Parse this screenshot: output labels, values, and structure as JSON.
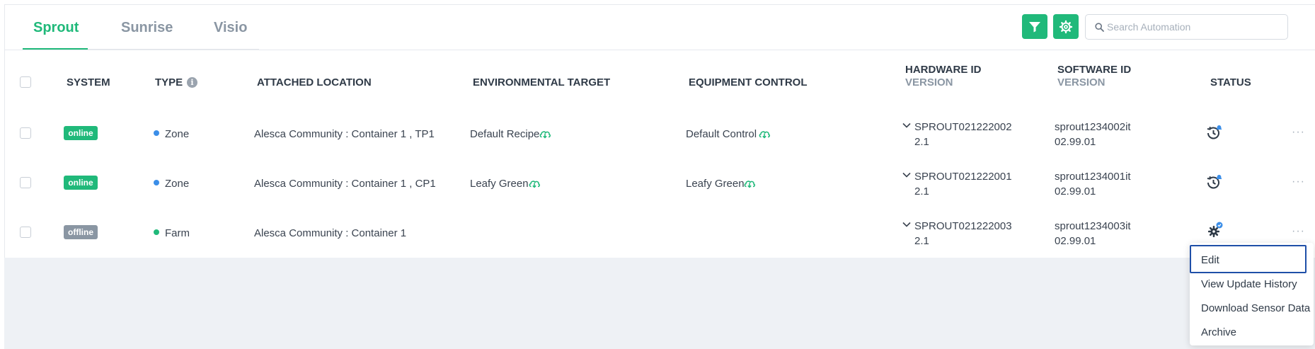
{
  "tabs": [
    {
      "label": "Sprout",
      "active": true
    },
    {
      "label": "Sunrise",
      "active": false
    },
    {
      "label": "Visio",
      "active": false
    }
  ],
  "toolbar": {
    "filter_icon": "filter-icon",
    "settings_icon": "gear-icon",
    "search_placeholder": "Search Automation",
    "search_value": ""
  },
  "table": {
    "headers": {
      "system": "SYSTEM",
      "type": "TYPE",
      "attached_location": "ATTACHED LOCATION",
      "environmental_target": "ENVIRONMENTAL TARGET",
      "equipment_control": "EQUIPMENT CONTROL",
      "hardware_id": "HARDWARE ID",
      "hardware_version": "VERSION",
      "software_id": "SOFTWARE ID",
      "software_version": "VERSION",
      "status": "STATUS"
    },
    "rows": [
      {
        "system": "online",
        "type": "Zone",
        "location": "Alesca Community : Container 1 , TP1",
        "env_target": "Default Recipe",
        "equipment": "Default Control",
        "hardware_id": "SPROUT021222002",
        "hardware_version": "2.1",
        "software_id": "sprout1234002it",
        "software_version": "02.99.01",
        "status_icon": "history-bell-icon",
        "more": "···"
      },
      {
        "system": "online",
        "type": "Zone",
        "location": "Alesca Community : Container 1 , CP1",
        "env_target": "Leafy Green",
        "equipment": "Leafy Green",
        "hardware_id": "SPROUT021222001",
        "hardware_version": "2.1",
        "software_id": "sprout1234001it",
        "software_version": "02.99.01",
        "status_icon": "history-bell-icon",
        "more": "···"
      },
      {
        "system": "offline",
        "type": "Farm",
        "location": "Alesca Community : Container 1",
        "env_target": "",
        "equipment": "",
        "hardware_id": "SPROUT021222003",
        "hardware_version": "2.1",
        "software_id": "sprout1234003it",
        "software_version": "02.99.01",
        "status_icon": "gear-check-icon",
        "more": "···"
      }
    ]
  },
  "menu": {
    "items": [
      "Edit",
      "View Update History",
      "Download Sensor Data",
      "Archive"
    ]
  },
  "colors": {
    "accent": "#20b97a",
    "zone_dot": "#3b8ee8",
    "farm_dot": "#20b97a",
    "offline": "#8a96a3",
    "focus": "#1f4fa8"
  }
}
